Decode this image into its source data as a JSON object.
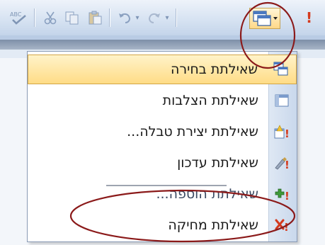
{
  "toolbar": {
    "buttons": [
      {
        "name": "spelling-icon",
        "glyph": "ᴬᴮᶜ✓"
      },
      {
        "name": "cut-icon",
        "glyph": "✂"
      },
      {
        "name": "copy-icon",
        "glyph": "❐"
      },
      {
        "name": "paste-icon",
        "glyph": "📋"
      },
      {
        "name": "undo-icon",
        "glyph": "↶"
      },
      {
        "name": "undo-dropdown-icon",
        "glyph": "▾"
      },
      {
        "name": "redo-icon",
        "glyph": "↷"
      },
      {
        "name": "redo-dropdown-icon",
        "glyph": "▾"
      },
      {
        "name": "query-type-dropdown-icon",
        "glyph": "▾"
      },
      {
        "name": "run-icon",
        "glyph": "!"
      }
    ]
  },
  "menu": {
    "items": [
      {
        "label": "שאילתת בחירה",
        "icon": "select-query-icon",
        "selected": true
      },
      {
        "label": "שאילתת הצלבות",
        "icon": "crosstab-query-icon",
        "selected": false
      },
      {
        "label": "שאילתת יצירת טבלה...",
        "icon": "make-table-query-icon",
        "selected": false
      },
      {
        "label": "שאילתת עדכון",
        "icon": "update-query-icon",
        "selected": false
      },
      {
        "label": "שאילתת הוספה...",
        "icon": "append-query-icon",
        "selected": false
      },
      {
        "label": "שאילתת מחיקה",
        "icon": "delete-query-icon",
        "selected": false
      }
    ]
  },
  "colors": {
    "annotation": "#8b1a1a",
    "highlight": "#ffdc86"
  }
}
